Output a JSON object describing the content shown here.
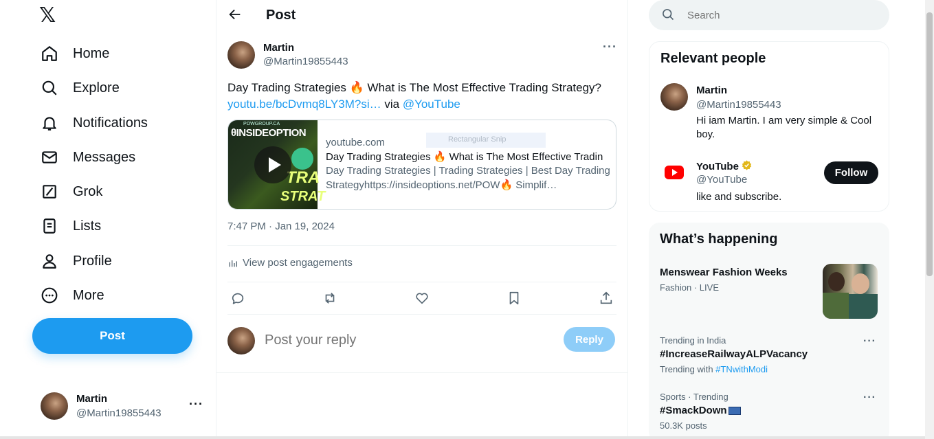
{
  "nav": {
    "logo": "𝕏",
    "items": [
      {
        "label": "Home",
        "icon": "home-icon"
      },
      {
        "label": "Explore",
        "icon": "search-icon"
      },
      {
        "label": "Notifications",
        "icon": "bell-icon"
      },
      {
        "label": "Messages",
        "icon": "mail-icon"
      },
      {
        "label": "Grok",
        "icon": "grok-icon"
      },
      {
        "label": "Lists",
        "icon": "list-icon"
      },
      {
        "label": "Profile",
        "icon": "person-icon"
      },
      {
        "label": "More",
        "icon": "more-circle-icon"
      }
    ],
    "post_label": "Post",
    "account": {
      "name": "Martin",
      "handle": "@Martin19855443",
      "more": "···"
    }
  },
  "header": {
    "title": "Post"
  },
  "tweet": {
    "name": "Martin",
    "handle": "@Martin19855443",
    "more": "···",
    "text_prefix": "Day Trading Strategies 🔥 What is The Most Effective Trading Strategy?",
    "link": "youtu.be/bcDvmq8LY3M?si…",
    "via": " via ",
    "mention": "@YouTube",
    "card": {
      "brand": "θINSIDEOPTION",
      "brand_sub": "POWGROUP.CA",
      "thumb_word1": "TRA",
      "thumb_word2": "STRAT",
      "domain": "youtube.com",
      "title": "Day Trading Strategies 🔥 What is The Most Effective Tradin",
      "description": "Day Trading Strategies | Trading Strategies | Best Day Trading Strategyhttps://insideoptions.net/POW🔥 Simplif…",
      "snip_label": "Rectangular Snip"
    },
    "timestamp": "7:47 PM · Jan 19, 2024",
    "engagements": "View post engagements"
  },
  "reply": {
    "placeholder": "Post your reply",
    "button": "Reply"
  },
  "search": {
    "placeholder": "Search"
  },
  "relevant_people": {
    "title": "Relevant people",
    "people": [
      {
        "name": "Martin",
        "handle": "@Martin19855443",
        "bio": "Hi iam Martin. I am very simple & Cool boy."
      },
      {
        "name": "YouTube",
        "handle": "@YouTube",
        "bio": "like and subscribe.",
        "follow": "Follow"
      }
    ]
  },
  "happening": {
    "title": "What’s happening",
    "trends": [
      {
        "title": "Menswear Fashion Weeks",
        "meta": "Fashion · LIVE"
      },
      {
        "meta": "Trending in India",
        "title": "#IncreaseRailwayALPVacancy",
        "sub_prefix": "Trending with ",
        "sub_link": "#TNwithModi",
        "more": "···"
      },
      {
        "meta": "Sports · Trending",
        "title": "#SmackDown",
        "sub": "50.3K posts",
        "more": "···"
      }
    ]
  },
  "colors": {
    "accent": "#1d9bf0",
    "text": "#0f1419",
    "muted": "#536471",
    "verified": "#e2b719",
    "youtube": "#ff0000"
  }
}
